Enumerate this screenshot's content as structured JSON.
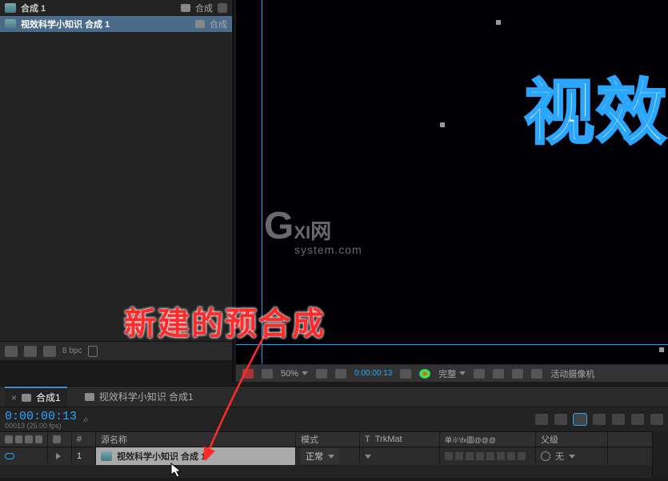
{
  "project": {
    "rows": [
      {
        "label": "合成 1",
        "type": "合成"
      },
      {
        "label": "视效科学小知识 合成 1",
        "type": "合成"
      }
    ]
  },
  "project_footer": {
    "bpc": "8 bpc"
  },
  "viewer": {
    "text": "视效",
    "watermark_prefix": "G",
    "watermark_mid": "XI",
    "watermark_cn": "网",
    "watermark_sub": "system.com"
  },
  "viewer_bar": {
    "zoom": "50%",
    "timecode": "0:00:00:13",
    "quality": "完整",
    "camera": "活动摄像机"
  },
  "timeline": {
    "tabs": [
      {
        "label": "合成1",
        "active": true
      },
      {
        "label": "视效科学小知识 合成1",
        "active": false
      }
    ],
    "timecode": "0:00:00:13",
    "timecode_sub": "00013 (25.00 fps)",
    "headers": {
      "index": "#",
      "source_name": "源名称",
      "mode": "模式",
      "trkmat_t": "T",
      "trkmat": "TrkMat",
      "switches": "单※\\fx圖@@@",
      "parent": "父级"
    },
    "layers": [
      {
        "index": "1",
        "name": "视效科学小知识 合成 1",
        "mode": "正常",
        "parent": "无"
      }
    ]
  },
  "annotation": "新建的预合成"
}
